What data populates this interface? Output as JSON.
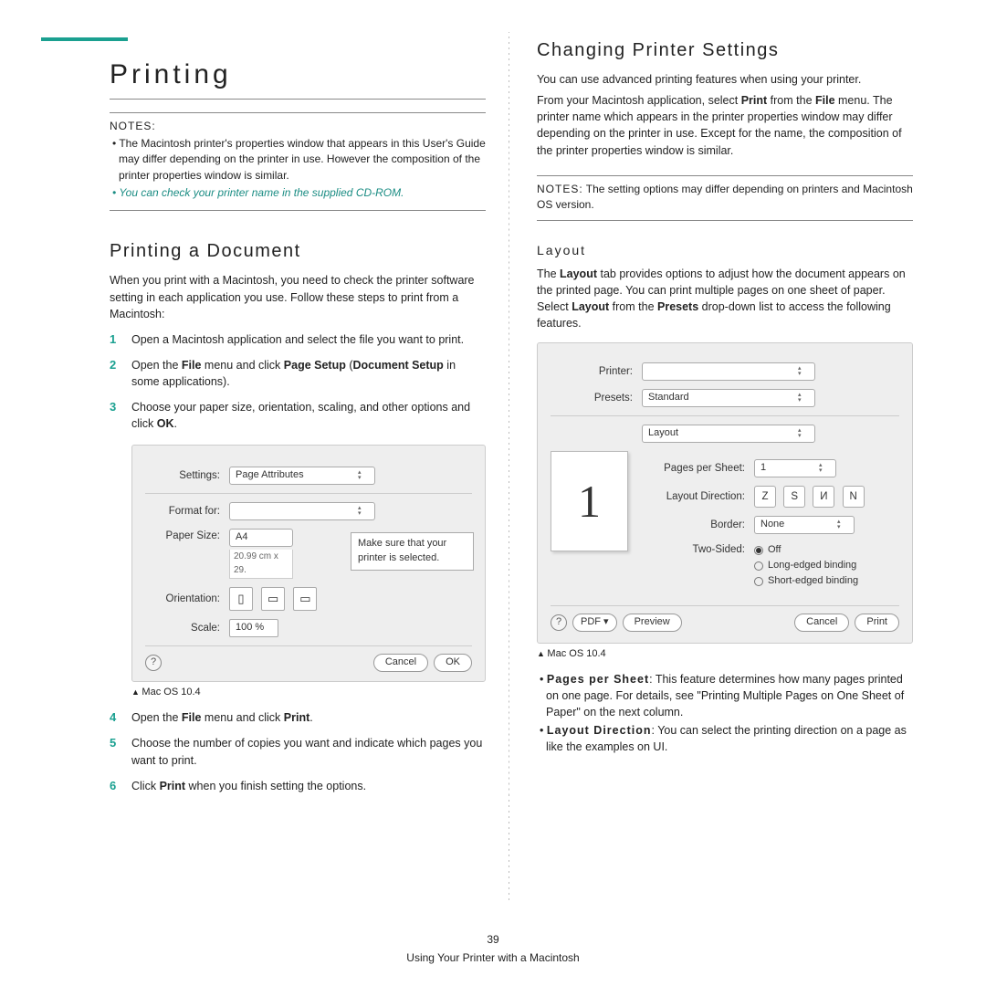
{
  "left": {
    "title": "Printing",
    "notes_label": "NOTES:",
    "note1": "The Macintosh printer's properties window that appears in this User's Guide may differ depending on the printer in use. However the composition of the printer properties window is similar.",
    "note2": "You can check your printer name in the supplied CD-ROM.",
    "h2": "Printing a Document",
    "intro": "When you print with a Macintosh, you need to check the printer software setting in each application you use. Follow these steps to print from a Macintosh:",
    "steps": {
      "s1": "Open a Macintosh application and select the file you want to print.",
      "s2a": "Open the ",
      "s2b": "File",
      "s2c": " menu and click ",
      "s2d": "Page Setup",
      "s2e": " (",
      "s2f": "Document Setup",
      "s2g": " in some applications).",
      "s3a": "Choose your paper size, orientation, scaling, and other options and click ",
      "s3b": "OK",
      "s3c": ".",
      "s4a": "Open the ",
      "s4b": "File",
      "s4c": " menu and click ",
      "s4d": "Print",
      "s4e": ".",
      "s5": "Choose the number of copies you want and indicate which pages you want to print.",
      "s6a": "Click ",
      "s6b": "Print",
      "s6c": " when you finish setting the options."
    },
    "dialog1": {
      "settings_label": "Settings:",
      "settings_value": "Page Attributes",
      "format_label": "Format for:",
      "format_value": "",
      "paper_label": "Paper Size:",
      "paper_value": "A4",
      "paper_dim": "20.99 cm x 29.",
      "orient_label": "Orientation:",
      "scale_label": "Scale:",
      "scale_value": "100 %",
      "cancel": "Cancel",
      "ok": "OK",
      "callout": "Make sure that your printer is selected."
    },
    "caption1": "Mac OS 10.4"
  },
  "right": {
    "h2": "Changing Printer Settings",
    "p1": "You can use advanced printing features when using your printer.",
    "p2a": "From your Macintosh application, select ",
    "p2b": "Print",
    "p2c": " from the ",
    "p2d": "File",
    "p2e": " menu. The printer name which appears in the printer properties window may differ depending on the printer in use. Except for the name, the composition of the printer properties window is similar.",
    "notes2_label": "NOTES:",
    "notes2_text": " The setting options may differ depending on printers and Macintosh OS version.",
    "h3": "Layout",
    "p3a": "The ",
    "p3b": "Layout",
    "p3c": " tab provides options to adjust how the document appears on the printed page. You can print multiple pages on one sheet of paper. Select ",
    "p3d": "Layout",
    "p3e": " from the ",
    "p3f": "Presets",
    "p3g": " drop-down list to access the following features.",
    "dialog2": {
      "printer_label": "Printer:",
      "printer_value": "",
      "presets_label": "Presets:",
      "presets_value": "Standard",
      "layout_value": "Layout",
      "pps_label": "Pages per Sheet:",
      "pps_value": "1",
      "dir_label": "Layout Direction:",
      "border_label": "Border:",
      "border_value": "None",
      "twosided_label": "Two-Sided:",
      "opt_off": "Off",
      "opt_long": "Long-edged binding",
      "opt_short": "Short-edged binding",
      "pdf": "PDF ▾",
      "preview": "Preview",
      "cancel": "Cancel",
      "print": "Print",
      "preview_num": "1"
    },
    "caption2": "Mac OS 10.4",
    "bul1a": "Pages per Sheet",
    "bul1b": ": This feature determines how many pages printed on one page. For details, see \"Printing Multiple Pages on One Sheet of Paper\" on the next column.",
    "bul2a": "Layout Direction",
    "bul2b": ": You can select the printing direction on a page as like the examples on UI."
  },
  "footer": {
    "page": "39",
    "text": "Using Your Printer with a Macintosh"
  }
}
